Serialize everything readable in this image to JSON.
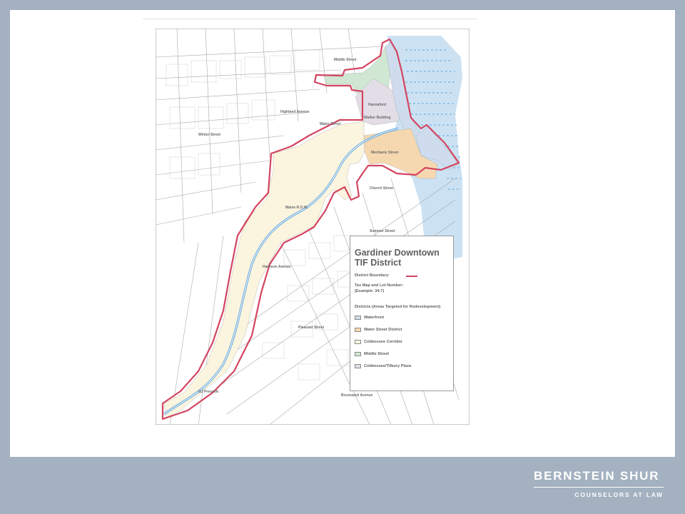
{
  "legend": {
    "title_line1": "Gardiner Downtown",
    "title_line2": "TIF District",
    "boundary_label": "District Boundary:",
    "taxmap_line1": "Tax Map and Lot Number:",
    "taxmap_line2": "(Example: 34-7)",
    "districts_heading": "Districts (Areas Targeted for Redevelopment)",
    "boundary_color": "#d44560",
    "districts": [
      {
        "label": "Waterfront",
        "color": "#cfdcee"
      },
      {
        "label": "Water Street District",
        "color": "#f6d8b0"
      },
      {
        "label": "Cobbossee Corridor",
        "color": "#fbf5df"
      },
      {
        "label": "Middle Street",
        "color": "#cfe7d3"
      },
      {
        "label": "Cobbossee/Tilbury Plaza",
        "color": "#e2dde6"
      }
    ]
  },
  "map_labels": {
    "hannaford": "Hannaford",
    "walker": "Walker Building",
    "water_st": "Water Street",
    "mechanic": "Mechanic Street",
    "middle_st": "Middle Street",
    "highland": "Highland Avenue",
    "rtaw": "Maine R.O.W.",
    "prescott": "GJ Prescott",
    "harrison": "Harrison Avenue",
    "pleasant": "Pleasant Street",
    "brunswick": "Brunswick Avenue",
    "winter": "Winter Street",
    "church": "Church Street",
    "summer": "Summer Street"
  },
  "brand": {
    "name": "BERNSTEIN SHUR",
    "tagline": "COUNSELORS AT LAW"
  }
}
